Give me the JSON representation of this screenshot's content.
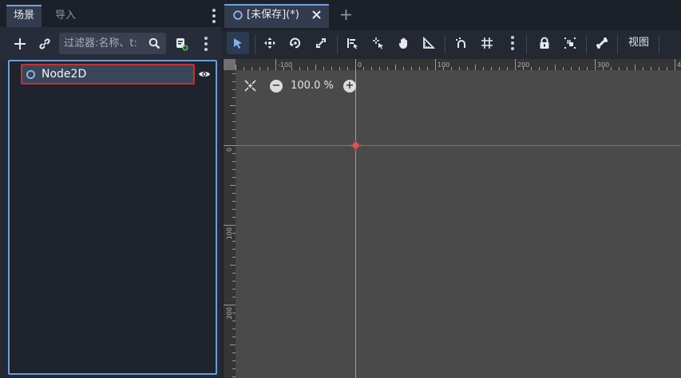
{
  "left_dock": {
    "tabs": [
      {
        "label": "场景",
        "active": true
      },
      {
        "label": "导入",
        "active": false
      }
    ],
    "toolbar": {
      "add_icon": "plus-icon",
      "link_icon": "link-icon",
      "filter_placeholder": "过滤器:名称、t:",
      "search_icon": "search-icon",
      "script_icon": "script-add-icon",
      "menu_icon": "kebab-menu-icon"
    },
    "tree": {
      "nodes": [
        {
          "name": "Node2D",
          "icon": "node2d-circle-icon",
          "visible_icon": "eye-icon",
          "selected": true
        }
      ]
    }
  },
  "main": {
    "tab": {
      "title": "[未保存](*)",
      "close_icon": "close-icon",
      "scene_icon": "node2d-circle-icon"
    },
    "new_tab_icon": "plus-icon",
    "toolbar": {
      "tools": [
        "select-arrow-icon",
        "move-icon",
        "rotate-icon",
        "scale-icon",
        "list-select-icon",
        "pivot-icon",
        "pan-hand-icon",
        "ruler-icon",
        "smart-snap-icon",
        "grid-snap-icon",
        "kebab-menu-icon",
        "lock-icon",
        "group-icon",
        "bone-icon"
      ],
      "view_menu": "视图"
    },
    "viewport": {
      "zoom": "100.0 %",
      "center_view_icon": "center-view-icon",
      "zoom_out_icon": "zoom-out-icon",
      "zoom_in_icon": "zoom-in-icon",
      "ruler_top_labels": [
        "-100",
        "0",
        "100",
        "200",
        "300",
        "40"
      ],
      "ruler_left_labels": [
        "0",
        "100",
        "200",
        "30"
      ],
      "colors": {
        "background": "#4a4a4a",
        "x_axis": "#c8506e",
        "y_axis": "#7fbf50",
        "origin": "#e05050"
      }
    }
  }
}
